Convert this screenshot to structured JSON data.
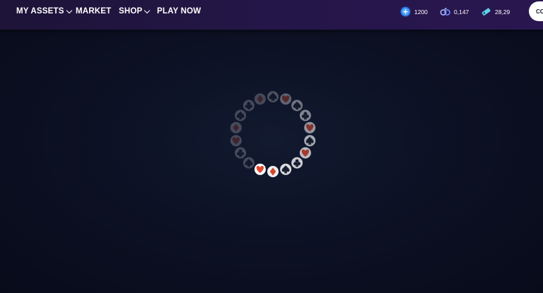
{
  "nav": {
    "items": [
      {
        "label": "MY ASSETS",
        "dropdown": true
      },
      {
        "label": "MARKET",
        "dropdown": false
      },
      {
        "label": "SHOP",
        "dropdown": true
      },
      {
        "label": "PLAY NOW",
        "dropdown": false
      }
    ]
  },
  "stats": [
    {
      "icon": "plus-token-icon",
      "value": "1200"
    },
    {
      "icon": "pow-token-icon",
      "value": "0,147"
    },
    {
      "icon": "ticket-token-icon",
      "value": "28,29"
    }
  ],
  "connect_button": {
    "label": "CO"
  },
  "loader": {
    "suits": [
      "spade",
      "heart",
      "spade",
      "club",
      "heart",
      "spade",
      "heart",
      "club",
      "spade",
      "diamond",
      "heart",
      "spade",
      "club",
      "heart",
      "diamond",
      "spade",
      "club",
      "diamond"
    ],
    "colors": {
      "red": "#e2492f",
      "dark": "#1b2033",
      "chip": "#ffffff"
    }
  }
}
